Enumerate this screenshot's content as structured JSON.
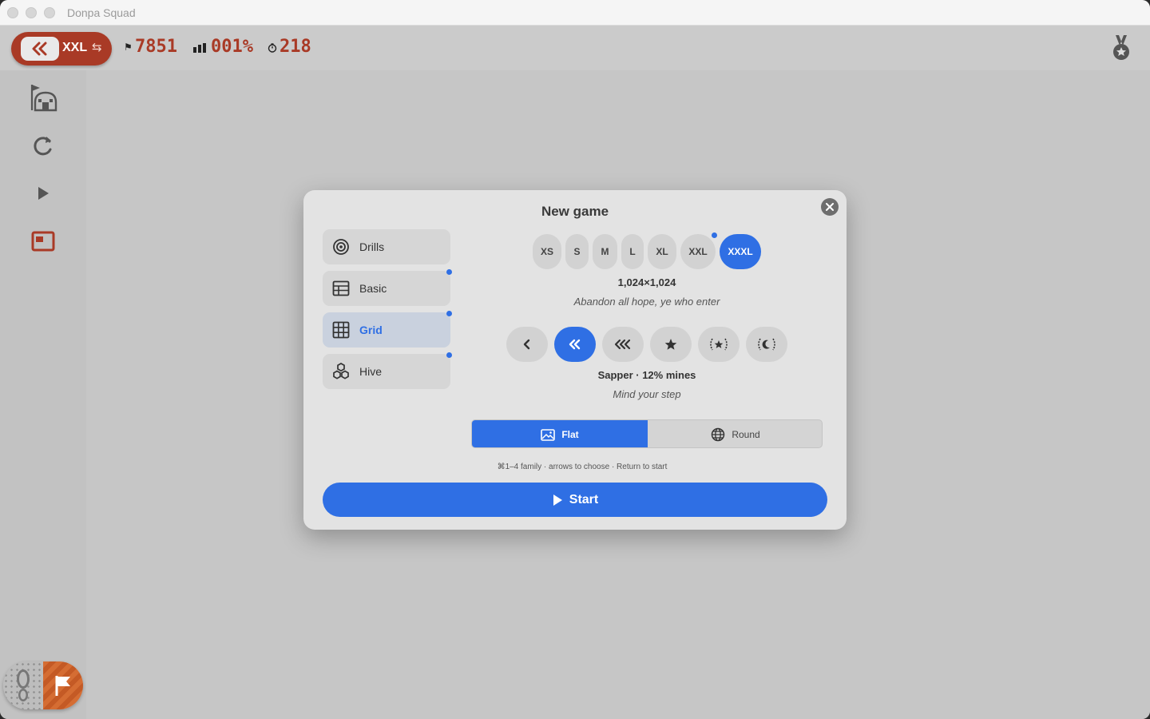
{
  "window": {
    "title": "Donpa Squad"
  },
  "toolbar": {
    "size_label": "XXL",
    "swap_glyph": "⇆",
    "flags": "7851",
    "progress": "001%",
    "timer": "218",
    "icons": [
      "double-chevron-left-icon",
      "flag-icon",
      "bars-icon",
      "timer-icon",
      "medal-icon"
    ]
  },
  "sidebar": {
    "items": [
      "hut-icon",
      "reload-icon",
      "play-icon",
      "window-icon"
    ],
    "bottom": [
      "footprint-icon",
      "flag-icon"
    ],
    "accent": "#a93a26"
  },
  "modal": {
    "title": "New game",
    "families": [
      {
        "label": "Drills",
        "icon": "target-icon"
      },
      {
        "label": "Basic",
        "icon": "table-icon"
      },
      {
        "label": "Grid",
        "icon": "grid-icon",
        "selected": true
      },
      {
        "label": "Hive",
        "icon": "hive-icon"
      }
    ],
    "sizes": [
      "XS",
      "S",
      "M",
      "L",
      "XL",
      "XXL",
      "XXXL"
    ],
    "selected_size": "XXXL",
    "dimensions": "1,024×1,024",
    "size_tagline": "Abandon all hope, ye who enter",
    "difficulties": [
      "chevron-left-icon",
      "double-chevron-left-icon",
      "triple-chevron-left-icon",
      "star-icon",
      "laurel-star-icon",
      "laurel-moon-icon"
    ],
    "difficulty_name": "Sapper · 12% mines",
    "difficulty_tagline": "Mind your step",
    "shape": {
      "flat": "Flat",
      "round": "Round",
      "selected": "Flat"
    },
    "hint": {
      "part1": "⌘1–4 family · arrows to choose · Return to start",
      "part2": ""
    },
    "start_label": "Start",
    "accent": "#2f6fe4"
  }
}
